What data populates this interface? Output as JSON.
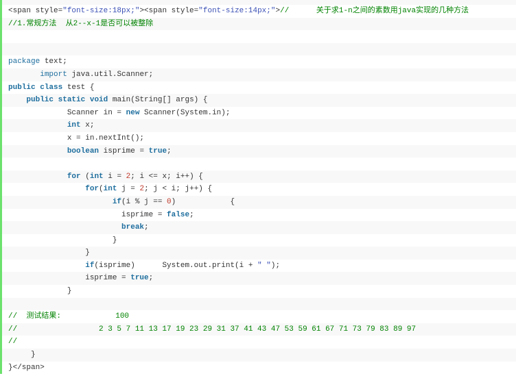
{
  "code_lines": [
    [
      [
        "tx",
        "<span style="
      ],
      [
        "str",
        "\"font-size:18px;\""
      ],
      [
        "tx",
        "><span style="
      ],
      [
        "str",
        "\"font-size:14px;\""
      ],
      [
        "tx",
        ">"
      ],
      [
        "cm",
        "//      关于求1-n之间的素数用java实现的几种方法"
      ]
    ],
    [
      [
        "cm",
        "//1.常规方法  从2--x-1是否可以被整除"
      ]
    ],
    [],
    [],
    [
      [
        "kw",
        "package"
      ],
      [
        "tx",
        " text;"
      ]
    ],
    [
      [
        "tx",
        "       "
      ],
      [
        "kw",
        "import"
      ],
      [
        "tx",
        " java.util.Scanner;"
      ]
    ],
    [
      [
        "kwb",
        "public"
      ],
      [
        "tx",
        " "
      ],
      [
        "kwb",
        "class"
      ],
      [
        "tx",
        " test {"
      ]
    ],
    [
      [
        "tx",
        "    "
      ],
      [
        "kwb",
        "public"
      ],
      [
        "tx",
        " "
      ],
      [
        "kwb",
        "static"
      ],
      [
        "tx",
        " "
      ],
      [
        "kwb",
        "void"
      ],
      [
        "tx",
        " main(String[] args) {"
      ]
    ],
    [
      [
        "tx",
        "             Scanner in = "
      ],
      [
        "kwb",
        "new"
      ],
      [
        "tx",
        " Scanner(System.in);"
      ]
    ],
    [
      [
        "tx",
        "             "
      ],
      [
        "kwb",
        "int"
      ],
      [
        "tx",
        " x;"
      ]
    ],
    [
      [
        "tx",
        "             x = in.nextInt();"
      ]
    ],
    [
      [
        "tx",
        "             "
      ],
      [
        "kwb",
        "boolean"
      ],
      [
        "tx",
        " isprime = "
      ],
      [
        "kwb",
        "true"
      ],
      [
        "tx",
        ";"
      ]
    ],
    [],
    [
      [
        "tx",
        "             "
      ],
      [
        "kwb",
        "for"
      ],
      [
        "tx",
        " ("
      ],
      [
        "kwb",
        "int"
      ],
      [
        "tx",
        " i = "
      ],
      [
        "num",
        "2"
      ],
      [
        "tx",
        "; i <= x; i++) {"
      ]
    ],
    [
      [
        "tx",
        "                 "
      ],
      [
        "kwb",
        "for"
      ],
      [
        "tx",
        "("
      ],
      [
        "kwb",
        "int"
      ],
      [
        "tx",
        " j = "
      ],
      [
        "num",
        "2"
      ],
      [
        "tx",
        "; j < i; j++) {"
      ]
    ],
    [
      [
        "tx",
        "                       "
      ],
      [
        "kwb",
        "if"
      ],
      [
        "tx",
        "(i % j == "
      ],
      [
        "num",
        "0"
      ],
      [
        "tx",
        ")            {"
      ]
    ],
    [
      [
        "tx",
        "                         isprime = "
      ],
      [
        "kwb",
        "false"
      ],
      [
        "tx",
        ";"
      ]
    ],
    [
      [
        "tx",
        "                         "
      ],
      [
        "kwb",
        "break"
      ],
      [
        "tx",
        ";"
      ]
    ],
    [
      [
        "tx",
        "                       }"
      ]
    ],
    [
      [
        "tx",
        "                 }"
      ]
    ],
    [
      [
        "tx",
        "                 "
      ],
      [
        "kwb",
        "if"
      ],
      [
        "tx",
        "(isprime)      System.out.print(i + "
      ],
      [
        "str",
        "\" \""
      ],
      [
        "tx",
        ");"
      ]
    ],
    [
      [
        "tx",
        "                 isprime = "
      ],
      [
        "kwb",
        "true"
      ],
      [
        "tx",
        ";"
      ]
    ],
    [
      [
        "tx",
        "             }"
      ]
    ],
    [],
    [
      [
        "cm",
        "//  测试结果:            100"
      ]
    ],
    [
      [
        "cm",
        "//                  2 3 5 7 11 13 17 19 23 29 31 37 41 43 47 53 59 61 67 71 73 79 83 89 97"
      ]
    ],
    [
      [
        "cm",
        "//"
      ]
    ],
    [
      [
        "tx",
        "     }"
      ]
    ],
    [
      [
        "tx",
        "}</span>"
      ]
    ]
  ]
}
